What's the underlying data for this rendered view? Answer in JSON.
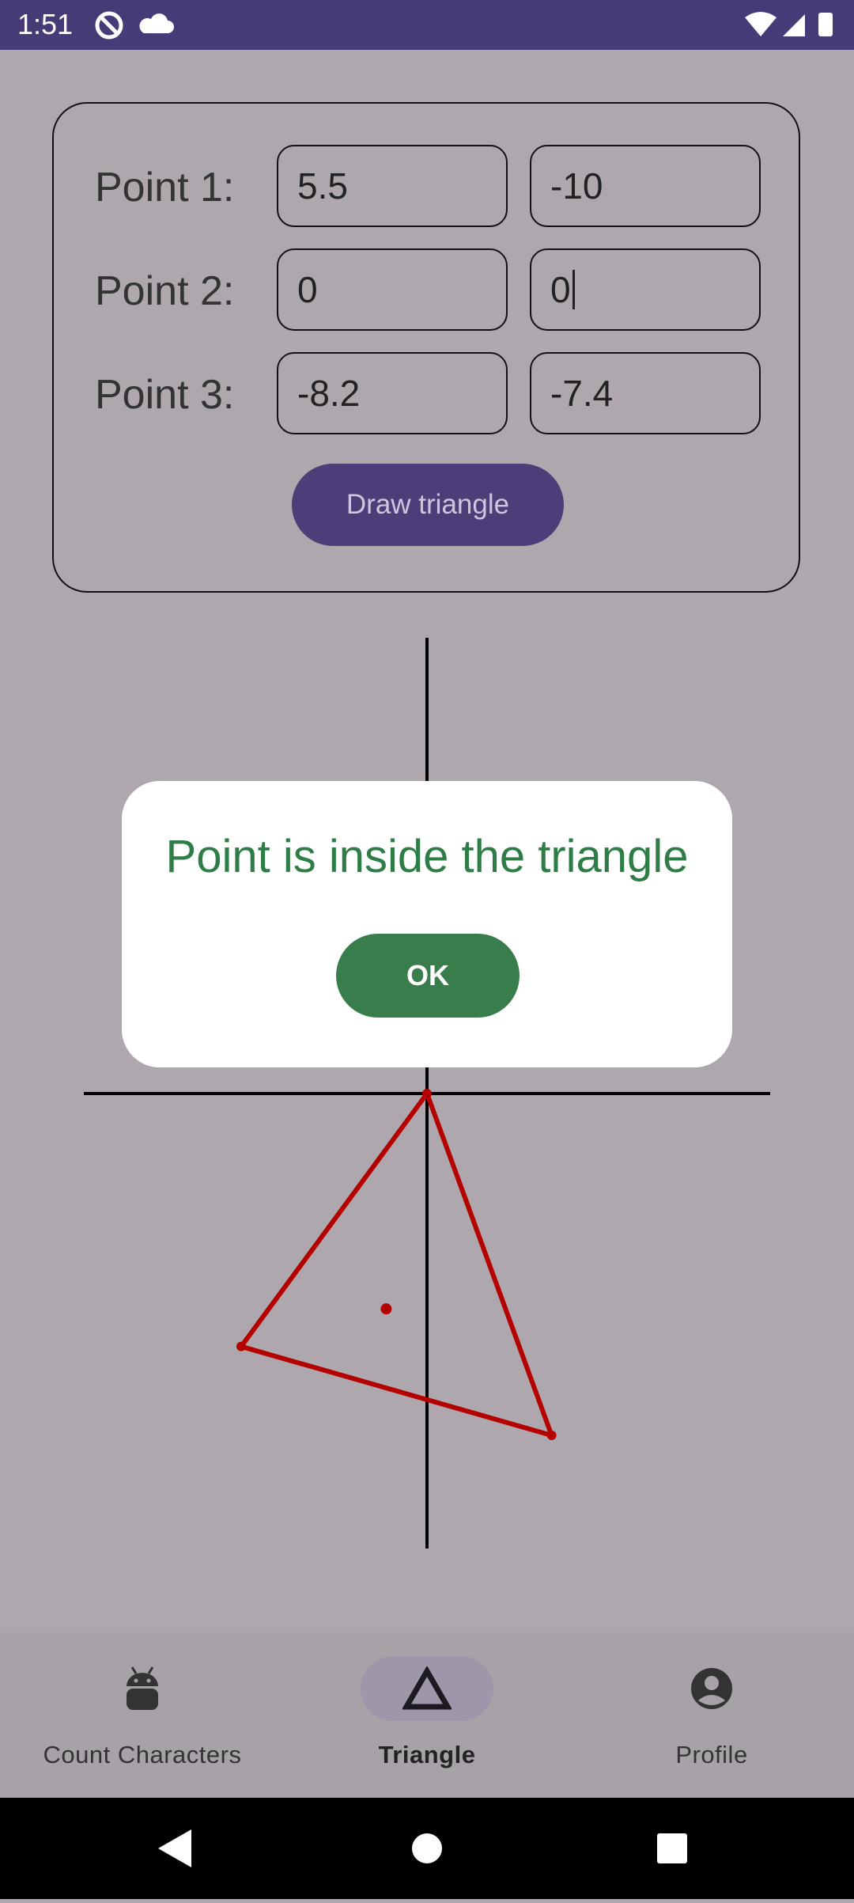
{
  "status_bar": {
    "time": "1:51",
    "icons_left": [
      "do-not-disturb-icon",
      "cloud-icon"
    ],
    "icons_right": [
      "wifi-icon",
      "signal-icon",
      "battery-icon"
    ]
  },
  "form": {
    "rows": [
      {
        "label": "Point 1:",
        "x": "5.5",
        "y": "-10"
      },
      {
        "label": "Point 2:",
        "x": "0",
        "y": "0"
      },
      {
        "label": "Point 3:",
        "x": "-8.2",
        "y": "-7.4"
      }
    ],
    "draw_button": "Draw triangle"
  },
  "graph": {
    "triangle_points": [
      [
        5.5,
        -10
      ],
      [
        0,
        0
      ],
      [
        -8.2,
        -7.4
      ]
    ],
    "test_point": [
      -1.8,
      -6.3
    ],
    "colors": {
      "triangle": "#b50000",
      "axes": "#000000"
    }
  },
  "dialog": {
    "message": "Point is inside the triangle",
    "ok_label": "OK",
    "message_color": "#2f7d46",
    "button_color": "#3a7d4c"
  },
  "bottom_nav": {
    "items": [
      {
        "label": "Count Characters",
        "icon": "android-icon",
        "active": false
      },
      {
        "label": "Triangle",
        "icon": "triangle-icon",
        "active": true
      },
      {
        "label": "Profile",
        "icon": "account-circle-icon",
        "active": false
      }
    ]
  },
  "system_nav": {
    "icons": [
      "back-icon",
      "home-icon",
      "recents-icon"
    ]
  }
}
